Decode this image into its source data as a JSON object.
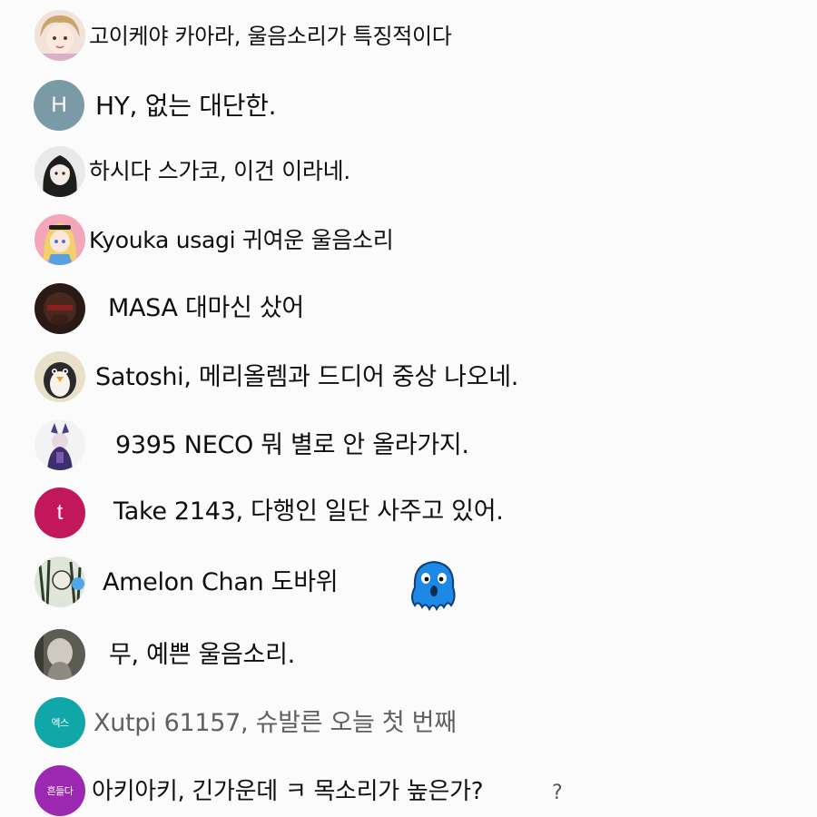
{
  "colors": {
    "background": "#fbfbfb",
    "text": "#0f0f0f",
    "muted_text": "#606060",
    "avatar_h": "#7a9aa6",
    "avatar_t": "#c2185b",
    "avatar_xutpi": "#11a6a8",
    "avatar_purple": "#9c27b0",
    "sticker_blue": "#1e88e5"
  },
  "messages": [
    {
      "author": "고이케야 카아라",
      "text": "고이케야 카아라, 울음소리가 특징적이다",
      "avatar_icon": "anime-girl-avatar-icon"
    },
    {
      "author": "HY",
      "text": "HY, 없는 대단한.",
      "avatar_letter": "H"
    },
    {
      "author": "하시다 스가코",
      "text": "하시다 스가코, 이건 이라네.",
      "avatar_icon": "dark-hair-girl-avatar-icon"
    },
    {
      "author": "Kyouka usagi",
      "text": "Kyouka usagi 귀여운 울음소리",
      "avatar_icon": "alice-avatar-icon"
    },
    {
      "author": "MASA",
      "text": "MASA 대마신 샀어",
      "avatar_icon": "dark-photo-avatar-icon"
    },
    {
      "author": "Satoshi",
      "text": "Satoshi, 메리올렘과 드디어 중상 나오네.",
      "avatar_icon": "penguin-avatar-icon"
    },
    {
      "author": "9395 NECO",
      "text": "9395 NECO 뭐 별로 안 올라가지.",
      "avatar_icon": "cat-character-avatar-icon"
    },
    {
      "author": "Take 2143",
      "text": "Take 2143, 다행인 일단 사주고 있어.",
      "avatar_letter": "t"
    },
    {
      "author": "Amelon Chan",
      "text": "Amelon Chan 도바위",
      "avatar_icon": "sketch-avatar-icon",
      "sticker_icon": "blue-ghost-sticker-icon"
    },
    {
      "author": "무",
      "text": "무, 예쁜 울음소리.",
      "avatar_icon": "gray-photo-avatar-icon"
    },
    {
      "author": "Xutpi 61157",
      "text": "Xutpi 61157, 슈발른 오늘 첫 번째",
      "avatar_text": "엑스"
    },
    {
      "author": "아키아키",
      "text": "아키아키, 긴가운데 ㅋ 목소리가 높은가?",
      "avatar_text": "흔들다",
      "trailing": "?"
    }
  ]
}
